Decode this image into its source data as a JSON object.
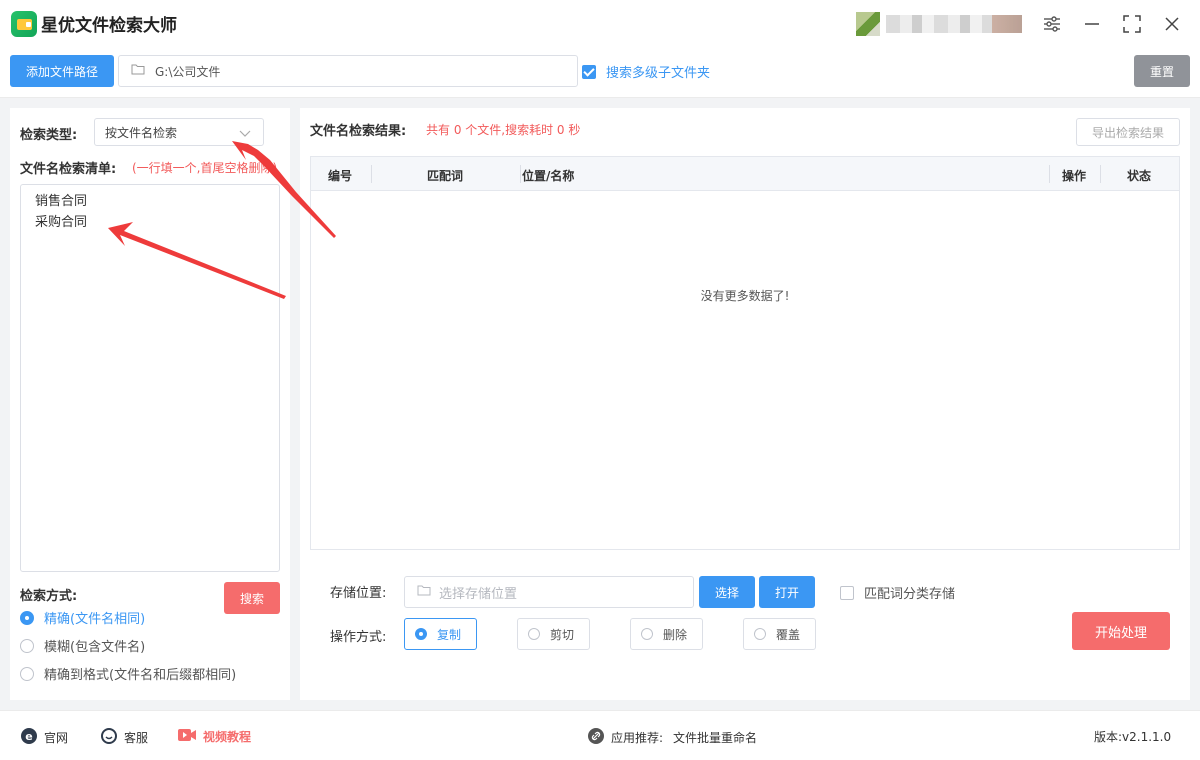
{
  "app": {
    "title": "星优文件检索大师"
  },
  "pathbar": {
    "add_path_label": "添加文件路径",
    "path_value": "G:\\公司文件",
    "subfolder_label": "搜索多级子文件夹",
    "subfolder_checked": true,
    "reset_label": "重置"
  },
  "left": {
    "type_label": "检索类型:",
    "type_value": "按文件名检索",
    "list_label": "文件名检索清单:",
    "list_hint": "(一行填一个,首尾空格删除)",
    "list_items": [
      "销售合同",
      "采购合同"
    ],
    "search_label": "搜索",
    "mode_label": "检索方式:",
    "modes": [
      {
        "label": "精确(文件名相同)",
        "selected": true
      },
      {
        "label": "模糊(包含文件名)",
        "selected": false
      },
      {
        "label": "精确到格式(文件名和后缀都相同)",
        "selected": false
      }
    ]
  },
  "right": {
    "result_label": "文件名检索结果:",
    "result_summary": "共有 0 个文件,搜索耗时 0 秒",
    "export_label": "导出检索结果",
    "columns": [
      "编号",
      "匹配词",
      "位置/名称",
      "操作",
      "状态"
    ],
    "empty_message": "没有更多数据了!",
    "store_label": "存储位置:",
    "store_placeholder": "选择存储位置",
    "choose_label": "选择",
    "open_label": "打开",
    "classify_label": "匹配词分类存储",
    "op_label": "操作方式:",
    "ops": [
      {
        "label": "复制",
        "selected": true
      },
      {
        "label": "剪切",
        "selected": false
      },
      {
        "label": "删除",
        "selected": false
      },
      {
        "label": "覆盖",
        "selected": false
      }
    ],
    "start_label": "开始处理"
  },
  "statusbar": {
    "website": "官网",
    "service": "客服",
    "video": "视频教程",
    "recommend_label": "应用推荐:",
    "recommend_value": "文件批量重命名",
    "version_label": "版本:",
    "version_value": "v2.1.1.0"
  },
  "colors": {
    "accent": "#3b97f3",
    "danger": "#f56c6c",
    "hint": "#f25a5a",
    "reset": "#909399"
  },
  "icons": [
    "app-logo",
    "settings-sliders-icon",
    "minimize-icon",
    "maximize-icon",
    "close-icon",
    "folder-icon",
    "chevron-down-icon",
    "ie-icon",
    "chat-icon",
    "video-icon",
    "link-icon"
  ]
}
